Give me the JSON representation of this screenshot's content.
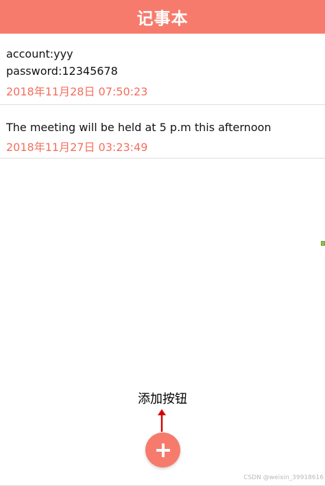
{
  "app": {
    "title": "记事本",
    "accent_color": "#f77b6c"
  },
  "notes": [
    {
      "content": "account:yyy\npassword:12345678",
      "time": "2018年11月28日 07:50:23"
    },
    {
      "content": "The meeting will be held at 5 p.m this afternoon",
      "time": "2018年11月27日 03:23:49"
    }
  ],
  "annotation": {
    "label": "添加按钮",
    "arrow_color": "#d70000"
  },
  "fab": {
    "icon": "plus-icon"
  },
  "watermark": {
    "text": "CSDN @weixin_39918616"
  }
}
